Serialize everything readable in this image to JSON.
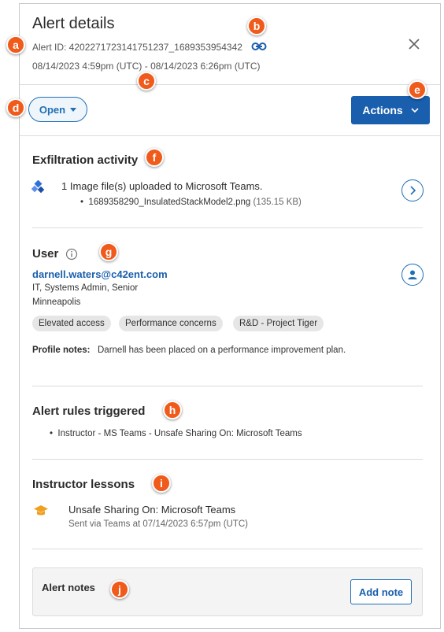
{
  "header": {
    "title": "Alert details",
    "alert_id": "Alert ID: 4202271723141751237_1689353954342",
    "time_range": "08/14/2023 4:59pm (UTC) - 08/14/2023 6:26pm (UTC)"
  },
  "toolbar": {
    "status_label": "Open",
    "actions_label": "Actions"
  },
  "exfiltration": {
    "title": "Exfiltration activity",
    "summary": "1 Image file(s) uploaded to Microsoft Teams.",
    "file_name": "1689358290_InsulatedStackModel2.png",
    "file_size": "(135.15 KB)"
  },
  "user": {
    "title": "User",
    "email": "darnell.waters@c42ent.com",
    "role": "IT, Systems Admin, Senior",
    "location": "Minneapolis",
    "tags": [
      "Elevated access",
      "Performance concerns",
      "R&D - Project Tiger"
    ],
    "profile_notes_label": "Profile notes:",
    "profile_notes": "Darnell has been placed on a performance improvement plan."
  },
  "rules": {
    "title": "Alert rules triggered",
    "items": [
      "Instructor - MS Teams - Unsafe Sharing On: Microsoft Teams"
    ]
  },
  "lessons": {
    "title": "Instructor lessons",
    "lesson_title": "Unsafe Sharing On: Microsoft Teams",
    "lesson_meta": "Sent via Teams at 07/14/2023 6:57pm (UTC)"
  },
  "notes": {
    "title": "Alert notes",
    "add_label": "Add note"
  },
  "markers": [
    "a",
    "b",
    "c",
    "d",
    "e",
    "f",
    "g",
    "h",
    "i",
    "j"
  ],
  "colors": {
    "accent": "#1a5fad",
    "marker": "#f05a1a",
    "lesson_icon": "#f0a020",
    "teams_icon": "#2f6fd8"
  },
  "icons": {
    "link": "link-icon",
    "close": "close-icon",
    "status_caret": "caret-down-icon",
    "actions_chevron": "chevron-down-icon",
    "teams": "teams-icon",
    "info": "info-icon",
    "profile": "user-profile-icon",
    "lesson": "graduation-cap-icon"
  }
}
